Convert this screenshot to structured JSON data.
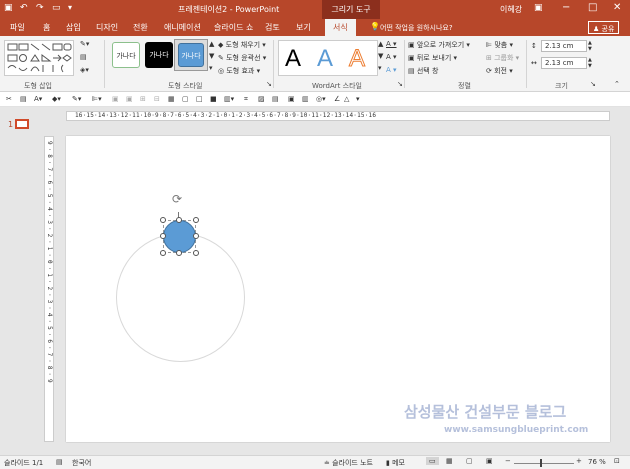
{
  "title": "프레젠테이션2 - PowerPoint",
  "contextual_tab": "그리기 도구",
  "user": "이혜강",
  "share": "공유",
  "tell_me": "어떤 작업을 원하시나요?",
  "tabs": [
    "파일",
    "홈",
    "삽입",
    "디자인",
    "전환",
    "애니메이션",
    "슬라이드 쇼",
    "검토",
    "보기",
    "서식"
  ],
  "ribbon": {
    "groups": {
      "insert_shapes": "도형 삽입",
      "shape_styles": "도형 스타일",
      "wordart": "WordArt 스타일",
      "arrange": "정렬",
      "size": "크기"
    },
    "style_sample": "가나다",
    "fill": "도형 채우기",
    "outline": "도형 윤곽선",
    "effects": "도형 효과",
    "wordart_letter": "A",
    "bring_forward": "앞으로 가져오기",
    "send_backward": "뒤로 보내기",
    "selection_pane": "선택 창",
    "align": "맞춤",
    "group": "그룹화",
    "rotate": "회전",
    "height": "2.13 cm",
    "width": "2.13 cm"
  },
  "ruler_h": "16·15·14·13·12·11·10·9·8·7·6·5·4·3·2·1·0·1·2·3·4·5·6·7·8·9·10·11·12·13·14·15·16",
  "ruler_v": "9·8·7·6·5·4·3·2·1·0·1·2·3·4·5·6·7·8·9",
  "thumb_number": "1",
  "status": {
    "slide": "슬라이드 1/1",
    "language": "한국어",
    "notes": "슬라이드 노트",
    "comments": "메모",
    "zoom": "76 %"
  },
  "watermark": {
    "line1": "삼성물산 건설부문 블로그",
    "line2": "www.samsungblueprint.com"
  },
  "colors": {
    "accent": "#b7472a",
    "shape_fill": "#5b9bd5",
    "shape_outline": "#41719c"
  }
}
